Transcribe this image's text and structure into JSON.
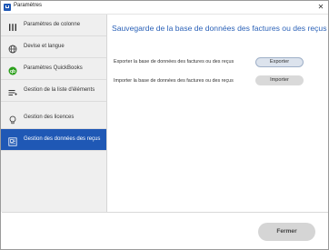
{
  "window": {
    "title": "Paramètres",
    "close_glyph": "✕"
  },
  "sidebar": {
    "items": [
      {
        "label": "Paramètres de colonne",
        "icon": "columns-icon"
      },
      {
        "label": "Devise et langue",
        "icon": "globe-icon"
      },
      {
        "label": "Paramètres QuickBooks",
        "icon": "quickbooks-icon"
      },
      {
        "label": "Gestion de la liste d'éléments",
        "icon": "list-icon"
      },
      {
        "label": "Gestion des licences",
        "icon": "lightbulb-icon"
      },
      {
        "label": "Gestion des données des reçus",
        "icon": "receipt-data-icon",
        "active": true
      }
    ]
  },
  "main": {
    "title": "Sauvegarde de la base de données des factures ou des reçus",
    "export_label": "Exporter la base de données des factures ou des reçus",
    "export_button": "Exporter",
    "import_label": "Importer la base de données des factures ou des reçus",
    "import_button": "Importer"
  },
  "footer": {
    "close_button": "Fermer"
  },
  "colors": {
    "accent": "#1f58b5",
    "title": "#2d63b8",
    "sidebar_bg": "#efefef",
    "button_bg": "#d9d9d9"
  }
}
